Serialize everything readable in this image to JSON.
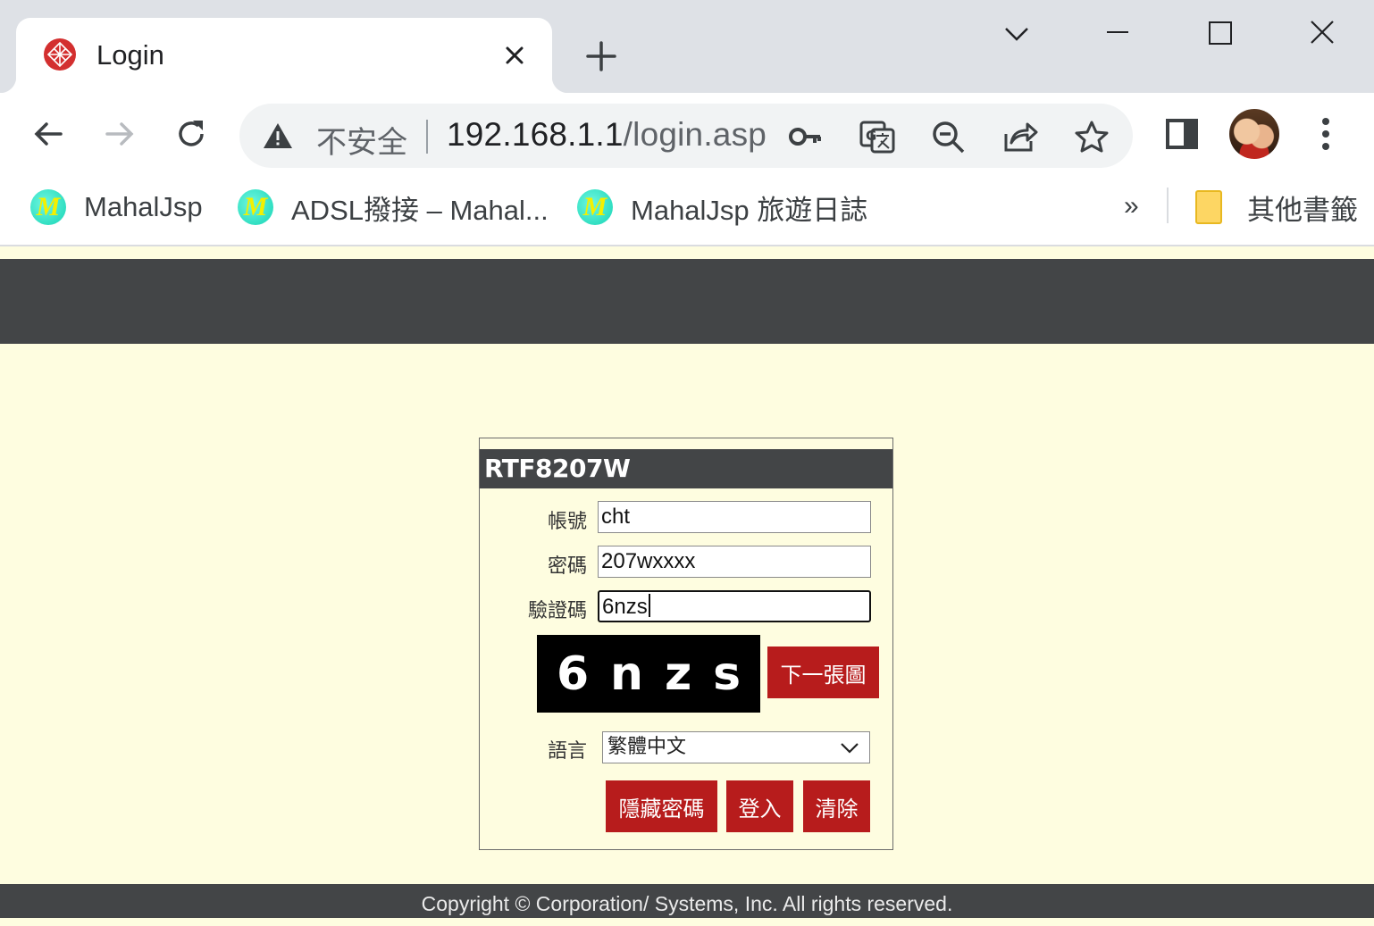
{
  "browser": {
    "tab": {
      "title": "Login",
      "favicon": "router-logo-icon"
    },
    "address": {
      "security_label": "不安全",
      "host": "192.168.1.1",
      "path": "/login.asp"
    },
    "bookmarks": [
      {
        "label": "MahalJsp",
        "icon": "M"
      },
      {
        "label": "ADSL撥接 – Mahal...",
        "icon": "M"
      },
      {
        "label": "MahalJsp 旅遊日誌",
        "icon": "M"
      }
    ],
    "bookmarks_more": "»",
    "other_bookmarks": "其他書籤"
  },
  "login": {
    "title": "RTF8207W",
    "username_label": "帳號",
    "username_value": "cht",
    "password_label": "密碼",
    "password_value": "207wxxxx",
    "captcha_label": "驗證碼",
    "captcha_value": "6nzs",
    "captcha_chars": [
      "6",
      "n",
      "z",
      "s"
    ],
    "next_image_button": "下一張圖",
    "language_label": "語言",
    "language_value": "繁體中文",
    "hide_password_button": "隱藏密碼",
    "login_button": "登入",
    "clear_button": "清除"
  },
  "footer": {
    "copyright": "Copyright ©  Corporation/ Systems, Inc. All rights reserved."
  },
  "colors": {
    "header": "#434547",
    "page_bg": "#fefde0",
    "button_red": "#b71c1c"
  }
}
